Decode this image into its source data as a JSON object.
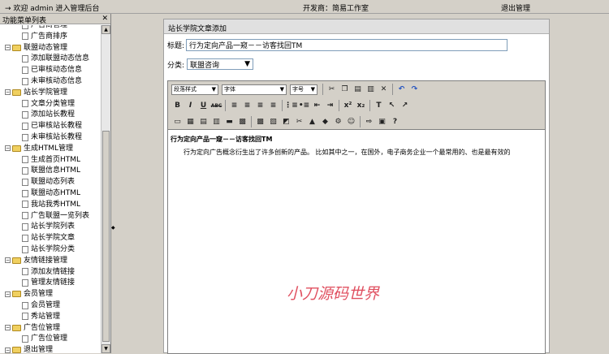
{
  "topbar": {
    "welcome": "→ 欢迎 admin 进入管理后台",
    "developer": "开发商：简易工作室",
    "logout": "退出管理"
  },
  "sidebar": {
    "title": "功能菜单列表",
    "tree": [
      {
        "type": "leaf",
        "label": "广告商管理"
      },
      {
        "type": "leaf",
        "label": "广告商排序"
      },
      {
        "type": "group",
        "label": "联盟动态管理"
      },
      {
        "type": "leaf",
        "label": "添加联盟动态信息"
      },
      {
        "type": "leaf",
        "label": "已审核动态信息"
      },
      {
        "type": "leaf",
        "label": "未审核动态信息"
      },
      {
        "type": "group",
        "label": "站长学院管理"
      },
      {
        "type": "leaf",
        "label": "文章分类管理"
      },
      {
        "type": "leaf",
        "label": "添加站长教程"
      },
      {
        "type": "leaf",
        "label": "已审核站长教程"
      },
      {
        "type": "leaf",
        "label": "未审核站长教程"
      },
      {
        "type": "group",
        "label": "生成HTML管理"
      },
      {
        "type": "leaf",
        "label": "生成首页HTML"
      },
      {
        "type": "leaf",
        "label": "联盟信息HTML"
      },
      {
        "type": "leaf",
        "label": "联盟动态列表"
      },
      {
        "type": "leaf",
        "label": "联盟动态HTML"
      },
      {
        "type": "leaf",
        "label": "我站我秀HTML"
      },
      {
        "type": "leaf",
        "label": "广告联盟一览列表"
      },
      {
        "type": "leaf",
        "label": "站长学院列表"
      },
      {
        "type": "leaf",
        "label": "站长学院文章"
      },
      {
        "type": "leaf",
        "label": "站长学院分类"
      },
      {
        "type": "group",
        "label": "友情链接管理"
      },
      {
        "type": "leaf",
        "label": "添加友情链接"
      },
      {
        "type": "leaf",
        "label": "管理友情链接"
      },
      {
        "type": "group",
        "label": "会员管理"
      },
      {
        "type": "leaf",
        "label": "会员管理"
      },
      {
        "type": "leaf",
        "label": "秀站管理"
      },
      {
        "type": "group",
        "label": "广告位管理"
      },
      {
        "type": "leaf",
        "label": "广告位管理"
      },
      {
        "type": "group",
        "label": "退出管理"
      }
    ]
  },
  "panel": {
    "title": "站长学院文章添加",
    "title_label": "标题:",
    "title_value": "行为定向产品一窥－－访客找回TM",
    "category_label": "分类:",
    "category_value": "联盟咨询"
  },
  "toolbar": {
    "style_select": "段落样式",
    "font_select": "字体",
    "size_select": "字号",
    "row2": [
      "B",
      "I",
      "U",
      "ABC",
      "≡",
      "≡",
      "≡",
      "≡",
      "⋮≡",
      "•≡",
      "⇤",
      "⇥",
      "x²",
      "x₂",
      "T",
      "↖",
      "↗"
    ],
    "row3": [
      "▭",
      "▦",
      "▤",
      "▥",
      "▬",
      "▩",
      "▩",
      "▧",
      "◩",
      "✂",
      "▲",
      "◆",
      "⚙",
      "☺",
      "⇨",
      "▣",
      "?"
    ]
  },
  "editor": {
    "heading": "行为定向产品一窥－－访客找回TM",
    "paragraph": "行为定向广告概念衍生出了许多创新的产品。 比如其中之一，在国外，电子商务企业一个最常用的、也是最有效的"
  },
  "watermark": "小刀源码世界"
}
